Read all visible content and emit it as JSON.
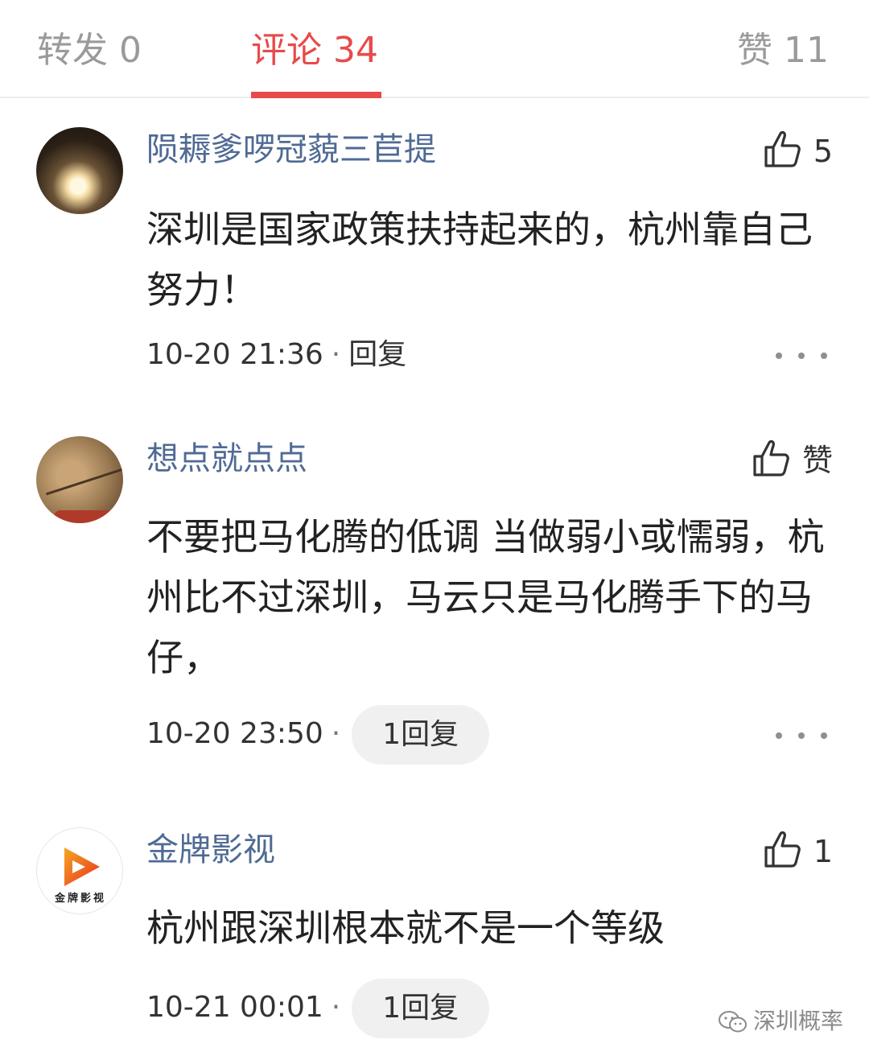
{
  "tabs": {
    "repost": {
      "label": "转发",
      "count": "0"
    },
    "comments": {
      "label": "评论",
      "count": "34"
    },
    "likes": {
      "label": "赞",
      "count": "11"
    }
  },
  "accent_color": "#e84a4a",
  "username_color": "#4f6a94",
  "comments": [
    {
      "username": "陨耨爹啰冠藐三苣提",
      "likes": "5",
      "text": "深圳是国家政策扶持起来的，杭州靠自己努力！",
      "time": "10-20 21:36",
      "reply": "回复"
    },
    {
      "username": "想点就点点",
      "likes": "赞",
      "text": "不要把马化腾的低调 当做弱小或懦弱，杭州比不过深圳，马云只是马化腾手下的马仔，",
      "time": "10-20 23:50",
      "reply": "1回复"
    },
    {
      "username": "金牌影视",
      "avatar_text": "金牌影视",
      "likes": "1",
      "text": "杭州跟深圳根本就不是一个等级",
      "time": "10-21 00:01",
      "reply": "1回复"
    }
  ],
  "watermark": "深圳概率"
}
